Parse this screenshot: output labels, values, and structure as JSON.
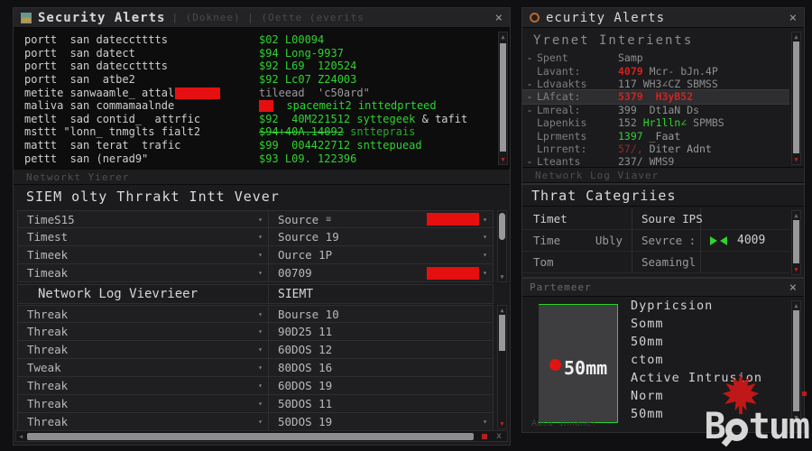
{
  "colors": {
    "accent_green": "#2fd32f",
    "alert_red": "#e60f0f",
    "panel_bg": "#1b1b1d",
    "terminal_bg": "#0d0d0e",
    "text": "#cfcfcf"
  },
  "left_panel": {
    "title": "Security Alerts",
    "title_extra": "| (Doknee) | (Oette (everits",
    "close": "×",
    "terminal_lines": [
      {
        "left": [
          {
            "t": "portt  san datecctttts",
            "c": "w"
          }
        ],
        "right": [
          {
            "t": "$02 L00094",
            "c": "g"
          }
        ]
      },
      {
        "left": [
          {
            "t": "portt  san datect",
            "c": "w"
          }
        ],
        "right": [
          {
            "t": "$94 Long-9937",
            "c": "g"
          }
        ]
      },
      {
        "left": [
          {
            "t": "portt  san datecctttts",
            "c": "w"
          }
        ],
        "right": [
          {
            "t": "$92 L69  120524",
            "c": "g"
          }
        ]
      },
      {
        "left": [
          {
            "t": "portt  san  atbe2",
            "c": "w"
          }
        ],
        "right": [
          {
            "t": "$92 Lc07 Z24003",
            "c": "g"
          }
        ]
      },
      {
        "left": [
          {
            "t": "metite sanwaamle_ attalts",
            "c": "w"
          },
          {
            "rb": true,
            "w": 50,
            "ml": -14
          }
        ],
        "right": [
          {
            "t": "tileead  'c50ard\"",
            "c": "gy"
          }
        ]
      },
      {
        "left": [
          {
            "t": "maliva san commamaalnde",
            "c": "w"
          }
        ],
        "right": [
          {
            "rb": true,
            "w": 16
          },
          {
            "t": "  spacemeit2 inttedprteed",
            "c": "g"
          }
        ]
      },
      {
        "left": [
          {
            "t": "metlt  sad contid_  attrfic",
            "c": "w"
          }
        ],
        "right": [
          {
            "t": "$92  40M221512 syttegeek",
            "c": "g"
          },
          {
            "t": " & tafit",
            "c": "w"
          }
        ]
      },
      {
        "left": [
          {
            "t": "msttt \"lonn_ tnmglts fialt2",
            "c": "w"
          }
        ],
        "right": [
          {
            "t": "$94+40Λ.14092",
            "c": "g st"
          },
          {
            "t": " sntteprais",
            "c": "gd"
          }
        ]
      },
      {
        "left": [
          {
            "t": "mattt  san terat  trafic",
            "c": "w"
          }
        ],
        "right": [
          {
            "t": "$99  004422712 snttepuead",
            "c": "g"
          }
        ]
      },
      {
        "left": [
          {
            "t": "pettt  san (nerad9\"",
            "c": "w"
          }
        ],
        "right": [
          {
            "t": "$93 L09. 122396",
            "c": "g"
          }
        ]
      }
    ],
    "net_viewer_label": "Networkt Yierer",
    "siem": {
      "header": "SIEM olty Thrrakt Intt Vever",
      "rows": [
        {
          "l": "TimeS15",
          "r": "Source",
          "menu": true,
          "red": true
        },
        {
          "l": "Timest",
          "r": "Source 19"
        },
        {
          "l": "Timeek",
          "r": "Ource 1P"
        },
        {
          "l": "Timeak",
          "r": "00709",
          "red": true
        }
      ]
    },
    "log": {
      "header_left": "Network Log Vievrieer",
      "header_right": "SIEMT",
      "rows": [
        {
          "l": "Threak",
          "r": "Bourse 10"
        },
        {
          "l": "Threak",
          "r": "90D25 11"
        },
        {
          "l": "Threak",
          "r": "60DOS 12"
        },
        {
          "l": "Tweak",
          "r": "80DOS 16"
        },
        {
          "l": "Threak",
          "r": "60DOS 19"
        },
        {
          "l": "Threak",
          "r": "50DOS 11"
        },
        {
          "l": "Threak",
          "r": "50DOS 19",
          "chev_r": true
        }
      ]
    }
  },
  "right_panel": {
    "alerts": {
      "title": "ecurity Alerts",
      "close": "×",
      "header": "Yrenet Interients",
      "rows": [
        {
          "dash": "-",
          "label": "Spent",
          "segs": [
            {
              "t": "Samp",
              "c": "gy2"
            }
          ]
        },
        {
          "dash": "",
          "label": "Lavant:",
          "segs": [
            {
              "t": "4079 ",
              "c": "r"
            },
            {
              "t": "Mcr- bJn.4P",
              "c": "gy2"
            }
          ]
        },
        {
          "dash": "-",
          "label": "Ldvaakts",
          "segs": [
            {
              "t": "117 WH3∠CZ SBMSS",
              "c": "gy2"
            }
          ]
        },
        {
          "dash": "-",
          "label": "LAfcat:",
          "segs": [
            {
              "t": "5379  H3yB52",
              "c": "r"
            }
          ],
          "hl": true
        },
        {
          "dash": "-",
          "label": "Lmreal:",
          "segs": [
            {
              "t": "399  Dt1aN Ds",
              "c": "gy2"
            }
          ]
        },
        {
          "dash": "",
          "label": "Lapenkis",
          "segs": [
            {
              "t": "152 ",
              "c": "gy2"
            },
            {
              "t": "Hr1lln∠",
              "c": "g"
            },
            {
              "t": " SPMBS",
              "c": "gy2"
            }
          ]
        },
        {
          "dash": "",
          "label": "Lprments",
          "segs": [
            {
              "t": "1397",
              "c": "g"
            },
            {
              "t": " _Faat",
              "c": "gy"
            }
          ]
        },
        {
          "dash": "",
          "label": "Lnrrent:",
          "segs": [
            {
              "t": "57/, ",
              "c": "rd"
            },
            {
              "t": "Diter Adnt",
              "c": "gy"
            }
          ]
        },
        {
          "dash": "-",
          "label": "Lteants",
          "segs": [
            {
              "t": "237/_WMS9",
              "c": "gy2"
            }
          ]
        }
      ],
      "footer_label": "Network Log Viaver"
    },
    "threats": {
      "header": "Thrat Categriies",
      "rows": [
        {
          "a": "Timet",
          "b": "",
          "c": "Soure IPS",
          "icons": false,
          "num": "",
          "hdr": true
        },
        {
          "a": "Time",
          "b": "Ubly",
          "c": "Sevrce :",
          "icons": true,
          "num": "4009",
          "hdr": false
        },
        {
          "a": "Tom",
          "b": "",
          "c": "Seamingl",
          "icons": false,
          "num": "",
          "hdr": false
        }
      ]
    },
    "partemeer": {
      "title": "Partemeer",
      "close": "×",
      "image_label": "50mm",
      "specs": [
        "Dypricsion",
        "Somm",
        "50mm",
        "ctom",
        "Active Intrusion",
        "Norm",
        "50mm"
      ],
      "status": "Aucd inhane!"
    }
  },
  "logo": {
    "b": "B",
    "rest": "tum"
  }
}
